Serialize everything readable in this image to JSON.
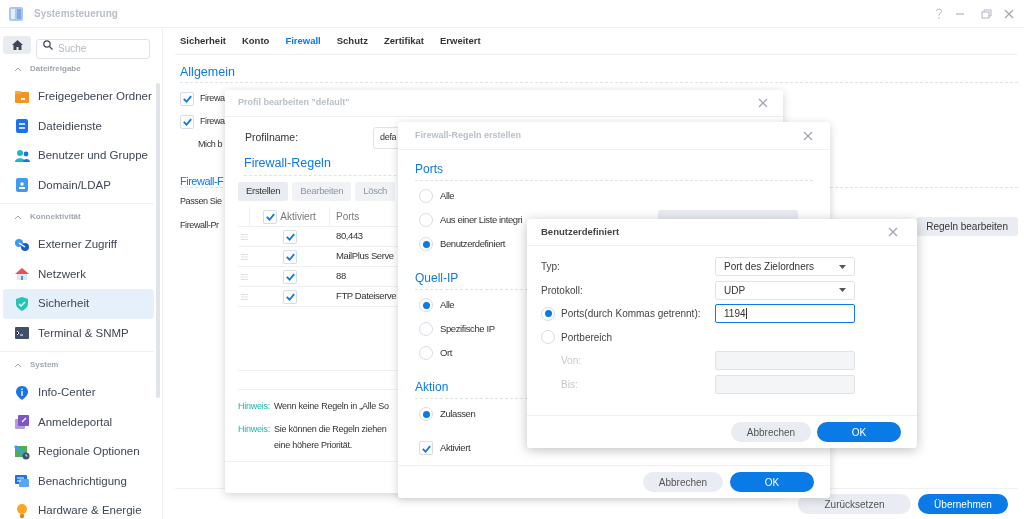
{
  "window": {
    "title": "Systemsteuerung"
  },
  "sidebar": {
    "search": {
      "placeholder": "Suche"
    },
    "sections": [
      {
        "title": "Dateifreigabe",
        "expanded": true,
        "items": [
          {
            "label": "Freigegebener Ordner",
            "kind": "folder",
            "selected": false
          },
          {
            "label": "Dateidienste",
            "kind": "files",
            "selected": false
          },
          {
            "label": "Benutzer und Gruppe",
            "kind": "users",
            "selected": false
          },
          {
            "label": "Domain/LDAP",
            "kind": "domain",
            "selected": false
          }
        ]
      },
      {
        "title": "Konnektivität",
        "expanded": true,
        "items": [
          {
            "label": "Externer Zugriff",
            "kind": "external",
            "selected": false
          },
          {
            "label": "Netzwerk",
            "kind": "network",
            "selected": false
          },
          {
            "label": "Sicherheit",
            "kind": "security",
            "selected": true
          },
          {
            "label": "Terminal & SNMP",
            "kind": "terminal",
            "selected": false
          }
        ]
      },
      {
        "title": "System",
        "expanded": true,
        "items": [
          {
            "label": "Info-Center",
            "kind": "info",
            "selected": false
          },
          {
            "label": "Anmeldeportal",
            "kind": "portal",
            "selected": false
          },
          {
            "label": "Regionale Optionen",
            "kind": "regional",
            "selected": false
          },
          {
            "label": "Benachrichtigung",
            "kind": "notification",
            "selected": false
          },
          {
            "label": "Hardware & Energie",
            "kind": "hardware",
            "selected": false
          }
        ]
      }
    ]
  },
  "tabs": [
    {
      "label": "Sicherheit",
      "selected": false
    },
    {
      "label": "Konto",
      "selected": false
    },
    {
      "label": "Firewall",
      "selected": true
    },
    {
      "label": "Schutz",
      "selected": false
    },
    {
      "label": "Zertifikat",
      "selected": false
    },
    {
      "label": "Erweitert",
      "selected": false
    }
  ],
  "general": {
    "heading": "Allgemein",
    "options": [
      {
        "label": "Firewa",
        "checked": true
      },
      {
        "label": "Firewa",
        "checked": true
      }
    ],
    "note": "Mich b"
  },
  "profile_section": {
    "heading": "Firewall-F",
    "description": "Passen Sie",
    "profile_label": "Firewall-Pr",
    "edit_button": "Regeln bearbeiten"
  },
  "footer_buttons": [
    {
      "label": "Zurücksetzen",
      "kind": "secondary"
    },
    {
      "label": "Übernehmen",
      "kind": "primary"
    }
  ],
  "profile_dialog": {
    "title": "Profil bearbeiten \"default\"",
    "name_label": "Profilname:",
    "name_value": "defa",
    "rules_heading": "Firewall-Regeln",
    "toolbar": [
      {
        "label": "Erstellen",
        "disabled": false
      },
      {
        "label": "Bearbeiten",
        "disabled": true
      },
      {
        "label": "Lösch",
        "disabled": true
      }
    ],
    "table": {
      "columns": [
        "Aktiviert",
        "Ports"
      ],
      "header_checked": true,
      "rows": [
        {
          "checked": true,
          "ports": "80,443"
        },
        {
          "checked": true,
          "ports": "MailPlus Serve"
        },
        {
          "checked": true,
          "ports": "88"
        },
        {
          "checked": true,
          "ports": "FTP Dateiserve"
        }
      ]
    },
    "hints": [
      {
        "label": "Hinweis:",
        "lines": [
          "Wenn keine Regeln in „Alle So"
        ]
      },
      {
        "label": "Hinweis:",
        "lines": [
          "Sie können die Regeln ziehen",
          "eine höhere Priorität."
        ]
      }
    ]
  },
  "rules_dialog": {
    "title": "Firewall-Regeln erstellen",
    "sections": [
      {
        "heading": "Ports",
        "options": [
          {
            "label": "Alle",
            "kind": "radio",
            "selected": false
          },
          {
            "label": "Aus einer Liste integri",
            "kind": "radio",
            "selected": false,
            "with_button": true
          },
          {
            "label": "Benutzerdefiniert",
            "kind": "radio",
            "selected": true
          }
        ]
      },
      {
        "heading": "Quell-IP",
        "options": [
          {
            "label": "Alle",
            "kind": "radio",
            "selected": true
          },
          {
            "label": "Spezifische IP",
            "kind": "radio",
            "selected": false
          },
          {
            "label": "Ort",
            "kind": "radio",
            "selected": false
          }
        ]
      },
      {
        "heading": "Aktion",
        "options": [
          {
            "label": "Zulassen",
            "kind": "radio",
            "selected": true
          },
          {
            "label": "Aktiviert",
            "kind": "checkbox",
            "checked": true
          }
        ]
      }
    ],
    "buttons": [
      {
        "label": "Abbrechen",
        "kind": "secondary"
      },
      {
        "label": "OK",
        "kind": "primary"
      }
    ]
  },
  "custom_dialog": {
    "title": "Benutzerdefiniert",
    "fields": [
      {
        "label": "Typ:",
        "kind": "select",
        "value": "Port des Zielordners"
      },
      {
        "label": "Protokoll:",
        "kind": "select",
        "value": "UDP"
      },
      {
        "label": "Ports(durch Kommas getrennt):",
        "kind": "radio_input",
        "selected": true,
        "value": "1194",
        "focused": true
      },
      {
        "label": "Portbereich",
        "kind": "radio",
        "selected": false
      },
      {
        "label": "Von:",
        "kind": "input",
        "disabled": true
      },
      {
        "label": "Bis:",
        "kind": "input",
        "disabled": true
      }
    ],
    "buttons": [
      {
        "label": "Abbrechen",
        "kind": "secondary"
      },
      {
        "label": "OK",
        "kind": "primary"
      }
    ]
  }
}
